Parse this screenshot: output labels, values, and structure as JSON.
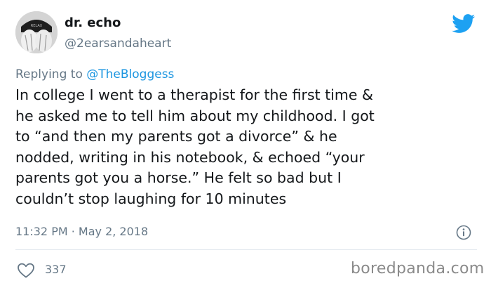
{
  "author": {
    "display_name": "dr. echo",
    "handle": "@2earsandaheart"
  },
  "reply": {
    "prefix": "Replying to",
    "mention": "@TheBloggess"
  },
  "tweet": {
    "text": "In college I went to a therapist for the first time &\nhe asked me to tell him about my childhood. I got\nto “and then my parents got a divorce” & he\nnodded, writing in his notebook, & echoed “your\nparents got you a horse.” He felt so bad but I\ncouldn’t stop laughing for 10 minutes",
    "timestamp": "11:32 PM · May 2, 2018",
    "like_count": "337"
  },
  "icons": {
    "brand": "twitter-bird-icon",
    "info": "info-icon",
    "like": "heart-icon"
  },
  "colors": {
    "brand": "#1da1f2",
    "mention": "#1b95e0",
    "secondary_text": "#657786"
  },
  "watermark": "boredpanda.com"
}
